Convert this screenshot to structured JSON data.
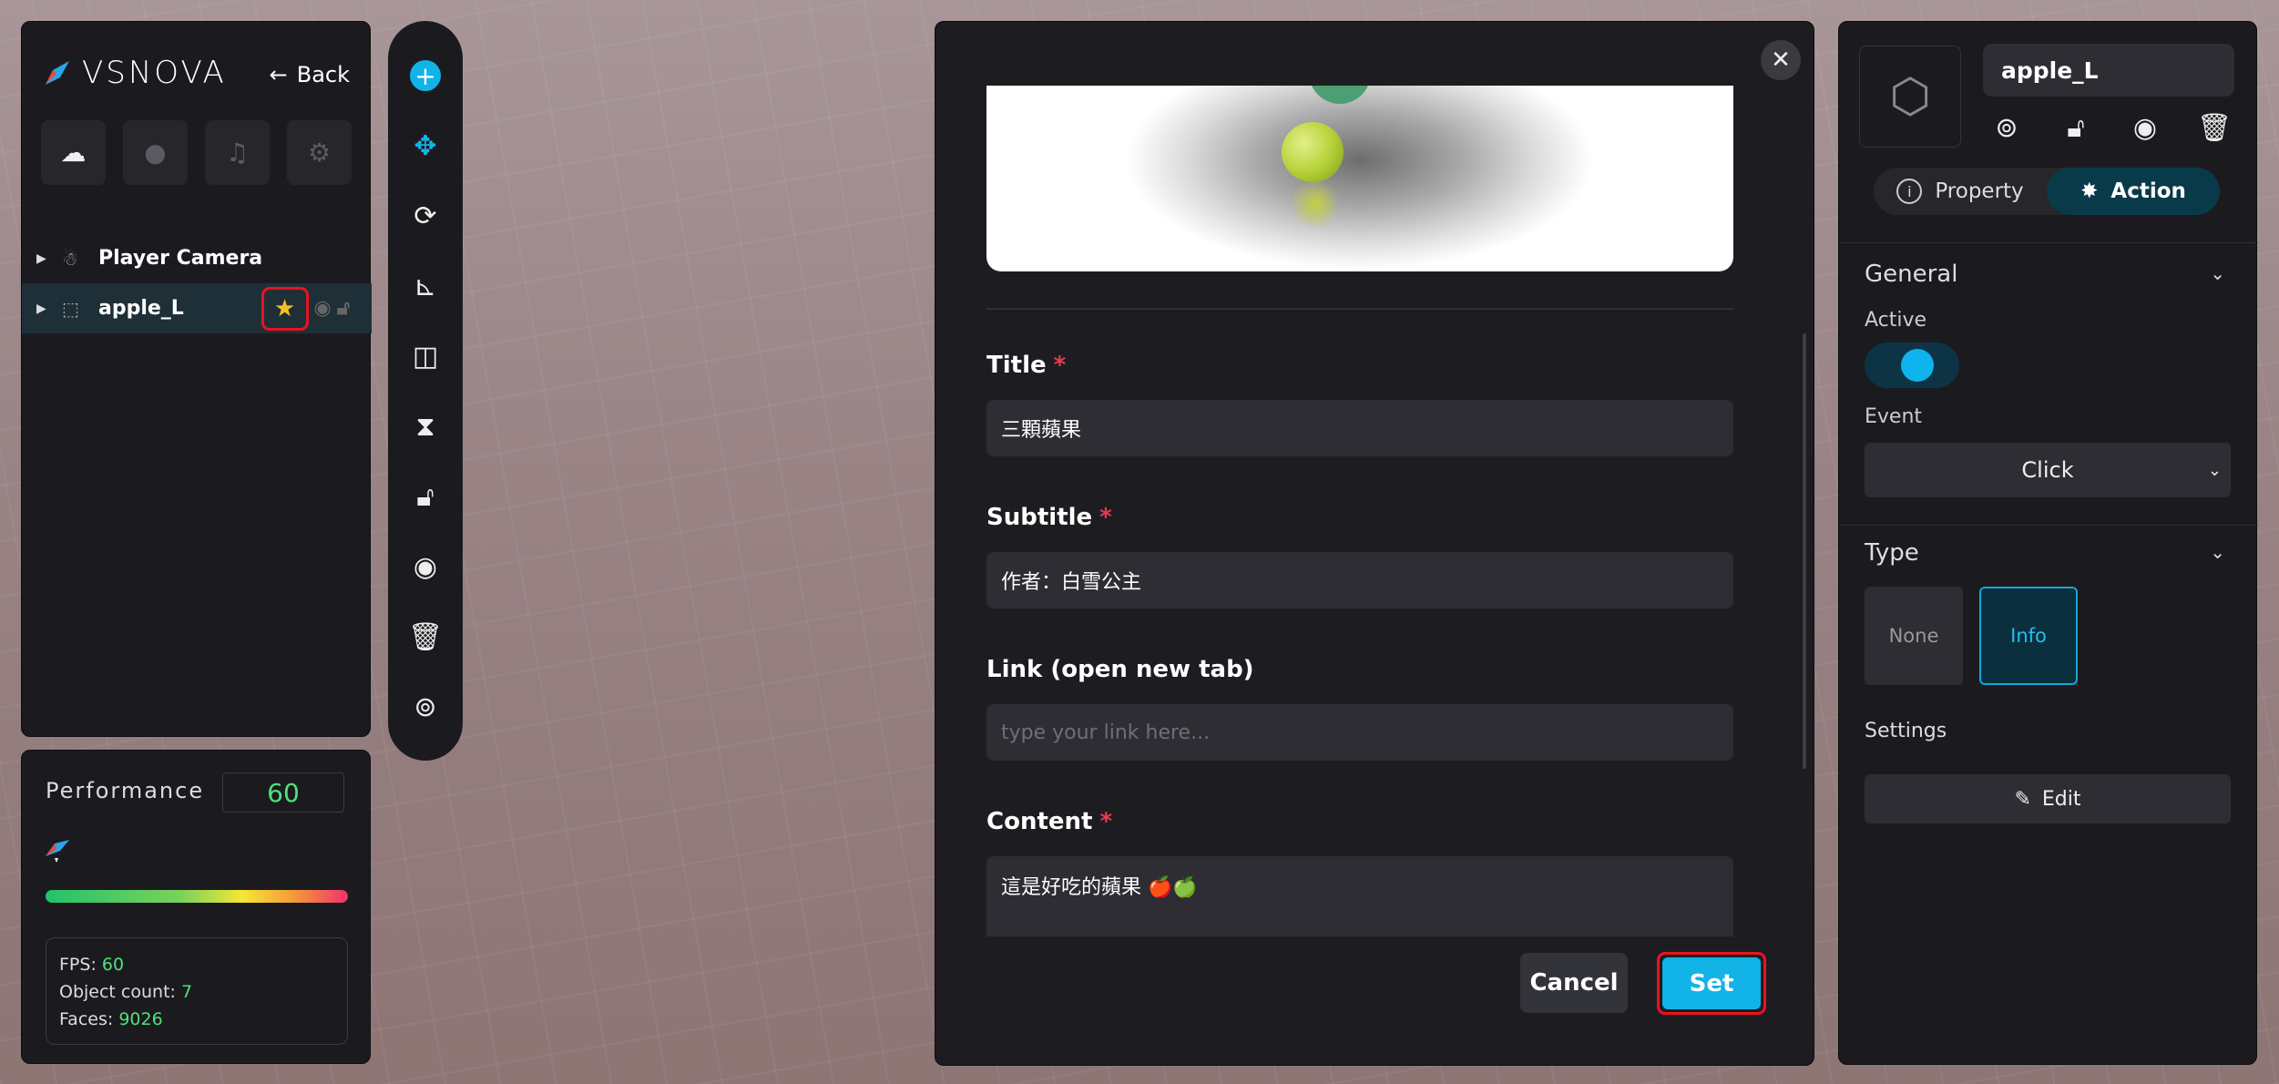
{
  "app": {
    "brand": "VSNOVA",
    "back_label": "Back"
  },
  "hierarchy": {
    "items": [
      {
        "label": "Player Camera",
        "icon": "person-icon"
      },
      {
        "label": "apple_L",
        "icon": "dashed-box-icon",
        "selected": true
      }
    ]
  },
  "top_tools": [
    "weather-icon",
    "person-icon",
    "music-icon",
    "settings-icon"
  ],
  "performance": {
    "title": "Performance",
    "value": "60",
    "fps_label": "FPS:",
    "fps": "60",
    "objects_label": "Object count:",
    "objects": "7",
    "faces_label": "Faces:",
    "faces": "9026",
    "bar_colors": [
      "#22c26b",
      "#f5e735",
      "#f0326c"
    ]
  },
  "vertical_tools": [
    "add-icon",
    "move-icon",
    "rotate-icon",
    "axis-icon",
    "mirror-icon",
    "scale-icon",
    "unlock-icon",
    "visibility-icon",
    "delete-icon",
    "focus-icon"
  ],
  "dialog": {
    "title_label": "Title",
    "title_value": "三顆蘋果",
    "subtitle_label": "Subtitle",
    "subtitle_value": "作者：白雪公主",
    "link_label": "Link (open new tab)",
    "link_placeholder": "type your link here...",
    "content_label": "Content",
    "content_value": "這是好吃的蘋果 🍎🍏",
    "required_mark": "*",
    "cancel_label": "Cancel",
    "set_label": "Set"
  },
  "inspector": {
    "object_name": "apple_L",
    "tabs": [
      {
        "label": "Property"
      },
      {
        "label": "Action",
        "active": true
      }
    ],
    "general_title": "General",
    "active_label": "Active",
    "active_on": true,
    "event_label": "Event",
    "event_value": "Click",
    "type_title": "Type",
    "type_options": [
      "None",
      "Info"
    ],
    "type_selected": "Info",
    "settings_label": "Settings",
    "edit_label": "Edit",
    "accent": "#12b3e6"
  }
}
